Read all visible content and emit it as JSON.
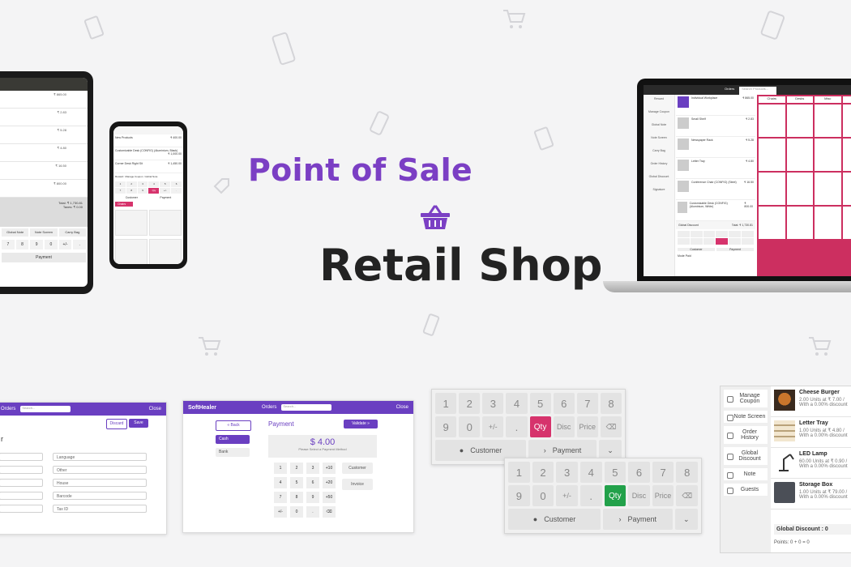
{
  "headline": {
    "line1": "Point of Sale",
    "line2": "Retail Shop"
  },
  "colors": {
    "purple": "#7b3fc4",
    "dark": "#232323",
    "pink": "#d6336c",
    "green": "#22a14a"
  },
  "tablet": {
    "amounts": [
      "₹ 865.00",
      "₹ 2.83",
      "₹ 5.28",
      "₹ 4.80",
      "₹ 16.50",
      "₹ 800.00"
    ],
    "total": "Total: ₹ 1,730.81",
    "taxes": "Taxes: ₹ 0.00",
    "buttons": [
      "Global Note",
      "Note Screen",
      "Carry Bag"
    ],
    "keys": [
      "7",
      "8",
      "9",
      "0",
      "+/-",
      "."
    ],
    "payment": "Payment"
  },
  "phone": {
    "items": [
      "New Products",
      "Customizable Desk (CONFIG) (Aluminium, Black)",
      "Corner Desk Right Sit"
    ],
    "prices": [
      "₹ 400.00",
      "₹ 1,000.00",
      "₹ 1,450.00"
    ],
    "tabs": [
      "Reward",
      "Manage Coupon",
      "Global Note"
    ],
    "keys": [
      "1",
      "2",
      "3",
      "4",
      "5",
      "6",
      "7",
      "8",
      "9",
      "Qty",
      "+/-",
      "."
    ],
    "customer": "Customer",
    "payment": "Payment",
    "category": "Chairs",
    "product": "New Products"
  },
  "laptop": {
    "header": "Orders",
    "search_placeholder": "Search Products...",
    "side": [
      "Reward",
      "Manage Coupon",
      "Global Note",
      "Note Screen",
      "Carry Bag",
      "Order History",
      "Global Discount",
      "Signature"
    ],
    "orders": [
      {
        "name": "Individual Workplace",
        "price": "₹ 865.00"
      },
      {
        "name": "Small Shelf",
        "price": "₹ 2.83"
      },
      {
        "name": "Newspaper Rack",
        "price": "₹ 5.28"
      },
      {
        "name": "Letter Tray",
        "price": "₹ 4.80"
      },
      {
        "name": "Conference Chair (CONFIG) (Steel)",
        "price": "₹ 16.50"
      },
      {
        "name": "Customizable Desk (CONFIG) (Aluminium, White)",
        "price": "₹ 800.00"
      }
    ],
    "global_discount": "Global Discount",
    "total": "Total: ₹ 1,730.81",
    "categories": [
      "Chairs",
      "Desks",
      "Misc"
    ],
    "customer": "Customer",
    "payment": "Payment",
    "mode": "Mode Paid"
  },
  "form_panel": {
    "brand_suffix": "Orders",
    "search": "Search...",
    "user": "Close",
    "discard": "Discard",
    "save": "Save",
    "label_r": "r",
    "fields": [
      "Language",
      "Other",
      "House",
      "Barcode",
      "Tax ID"
    ]
  },
  "payment_panel": {
    "brand": "SoftHealer",
    "header": "Orders",
    "search": "Search...",
    "user": "Close",
    "back": "Back",
    "title": "Payment",
    "validate": "Validate",
    "method": "Cash",
    "method2": "Bank",
    "amount": "$ 4.00",
    "hint": "Please Select a Payment Method",
    "keys": [
      "1",
      "2",
      "3",
      "+10",
      "4",
      "5",
      "6",
      "+20",
      "7",
      "8",
      "9",
      "+50",
      "+/-",
      "0",
      "."
    ],
    "customer": "Customer",
    "invoice": "Invoice"
  },
  "keypad1": {
    "row1": [
      "1",
      "2",
      "3",
      "4",
      "5",
      "6",
      "7",
      "8"
    ],
    "row2": [
      "9",
      "0",
      "+/-",
      ".",
      "Qty",
      "Disc",
      "Price"
    ],
    "customer": "Customer",
    "payment": "Payment"
  },
  "keypad2": {
    "row1": [
      "1",
      "2",
      "3",
      "4",
      "5",
      "6",
      "7",
      "8"
    ],
    "row2": [
      "9",
      "0",
      "+/-",
      ".",
      "Qty",
      "Disc",
      "Price"
    ],
    "customer": "Customer",
    "payment": "Payment"
  },
  "order_panel": {
    "nav": [
      "Manage Coupon",
      "Note Screen",
      "Order History",
      "Global Discount",
      "Note",
      "Guests"
    ],
    "lines": [
      {
        "name": "Cheese Burger",
        "qty": "2.00 Units at ₹ 7.00 /",
        "disc": "With a 0.00% discount"
      },
      {
        "name": "Letter Tray",
        "qty": "1.00 Units at ₹ 4.80 /",
        "disc": "With a 0.00% discount"
      },
      {
        "name": "LED Lamp",
        "qty": "60.00 Units at ₹ 0.90 /",
        "disc": "With a 0.00% discount"
      },
      {
        "name": "Storage Box",
        "qty": "1.00 Units at ₹ 79.00 /",
        "disc": "With a 0.00% discount"
      }
    ],
    "global_discount": "Global Discount :",
    "global_discount_value": "0",
    "points": "Points: 0 + 0 = 0"
  }
}
